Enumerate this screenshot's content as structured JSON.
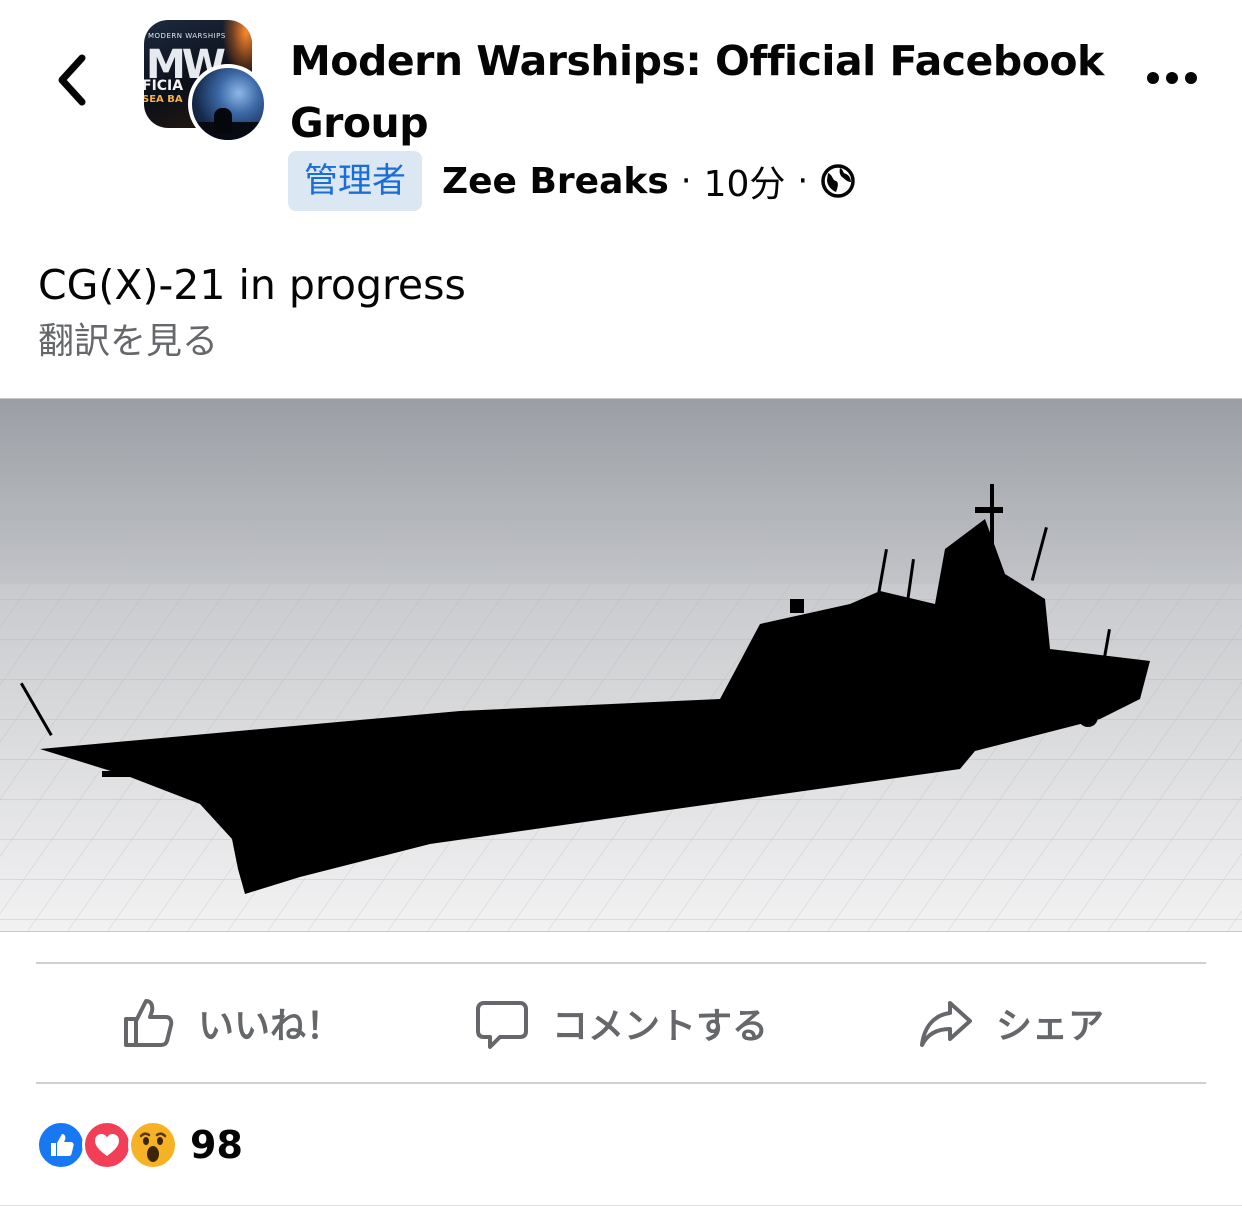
{
  "header": {
    "group_name": "Modern Warships: Official Facebook Group",
    "admin_badge": "管理者",
    "author": "Zee Breaks",
    "separator": "·",
    "time": "10分",
    "privacy_icon": "globe-icon",
    "avatar_text": {
      "top": "MODERN WARSHIPS",
      "big": "MW",
      "mid": "FICIA",
      "mid2": "SEA BA"
    }
  },
  "post": {
    "text": "CG(X)-21 in progress",
    "translate_label": "翻訳を見る",
    "image_alt": "black warship render on grid"
  },
  "actions": {
    "like_label": "いいね！",
    "comment_label": "コメントする",
    "share_label": "シェア"
  },
  "reactions": {
    "types": [
      "like",
      "love",
      "wow"
    ],
    "count": "98"
  },
  "colors": {
    "accent": "#1877f2",
    "admin_badge_bg": "#dbe7f2",
    "admin_badge_text": "#1a6ed8",
    "secondary_text": "#65676b",
    "love": "#f33e58",
    "wow": "#f7b125"
  }
}
